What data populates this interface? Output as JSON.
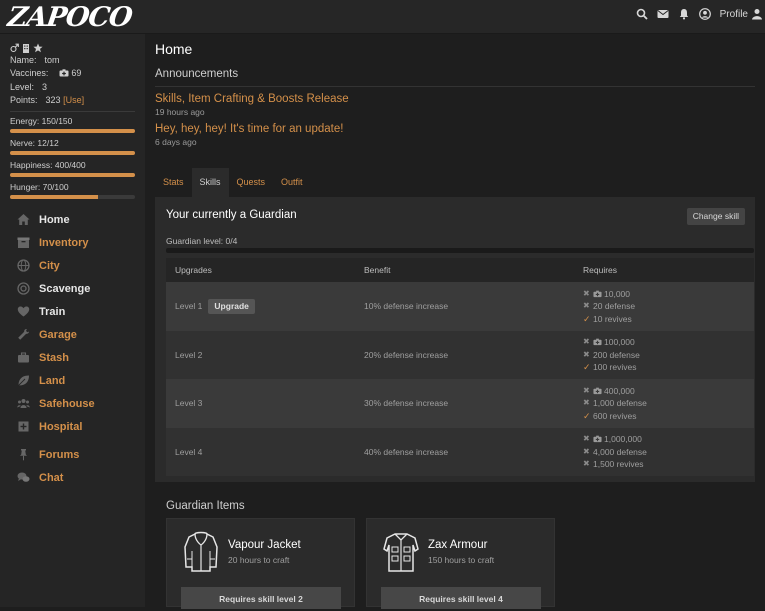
{
  "app": {
    "logo": "ZAPOCO"
  },
  "header": {
    "profile_label": "Profile"
  },
  "player": {
    "name_label": "Name:",
    "name": "tom",
    "vaccines_label": "Vaccines:",
    "vaccines": "69",
    "level_label": "Level:",
    "level": "3",
    "points_label": "Points:",
    "points": "323",
    "use_label": "[Use]"
  },
  "bars": [
    {
      "label": "Energy: 150/150",
      "fill": 1.0
    },
    {
      "label": "Nerve: 12/12",
      "fill": 1.0
    },
    {
      "label": "Happiness: 400/400",
      "fill": 1.0
    },
    {
      "label": "Hunger: 70/100",
      "fill": 0.7
    }
  ],
  "nav": [
    {
      "label": "Home",
      "icon": "home-icon"
    },
    {
      "label": "Inventory",
      "icon": "box-icon"
    },
    {
      "label": "City",
      "icon": "globe-icon"
    },
    {
      "label": "Scavenge",
      "icon": "target-icon"
    },
    {
      "label": "Train",
      "icon": "heart-icon"
    },
    {
      "label": "Garage",
      "icon": "wrench-icon"
    },
    {
      "label": "Stash",
      "icon": "briefcase-icon"
    },
    {
      "label": "Land",
      "icon": "leaf-icon"
    },
    {
      "label": "Safehouse",
      "icon": "people-icon"
    },
    {
      "label": "Hospital",
      "icon": "hospital-icon"
    },
    {
      "label": "Forums",
      "icon": "pin-icon"
    },
    {
      "label": "Chat",
      "icon": "chat-icon"
    }
  ],
  "page": {
    "title": "Home"
  },
  "announcements": {
    "title": "Announcements",
    "items": [
      {
        "title": "Skills, Item Crafting & Boosts Release",
        "date": "19 hours ago"
      },
      {
        "title": "Hey, hey, hey! It's time for an update!",
        "date": "6 days ago"
      }
    ]
  },
  "tabs": [
    "Stats",
    "Skills",
    "Quests",
    "Outfit"
  ],
  "skill": {
    "title": "Your currently a Guardian",
    "change_label": "Change skill",
    "level_label": "Guardian level: 0/4",
    "progress": 0,
    "headers": [
      "Upgrades",
      "Benefit",
      "Requires"
    ],
    "upgrade_label": "Upgrade",
    "rows": [
      {
        "level": "Level 1",
        "benefit": "10% defense increase",
        "req": [
          {
            "met": false,
            "vax": true,
            "text": "10,000"
          },
          {
            "met": false,
            "vax": false,
            "text": "20 defense"
          },
          {
            "met": true,
            "vax": false,
            "text": "10 revives"
          }
        ]
      },
      {
        "level": "Level 2",
        "benefit": "20% defense increase",
        "req": [
          {
            "met": false,
            "vax": true,
            "text": "100,000"
          },
          {
            "met": false,
            "vax": false,
            "text": "200 defense"
          },
          {
            "met": true,
            "vax": false,
            "text": "100 revives"
          }
        ]
      },
      {
        "level": "Level 3",
        "benefit": "30% defense increase",
        "req": [
          {
            "met": false,
            "vax": true,
            "text": "400,000"
          },
          {
            "met": false,
            "vax": false,
            "text": "1,000 defense"
          },
          {
            "met": true,
            "vax": false,
            "text": "600 revives"
          }
        ]
      },
      {
        "level": "Level 4",
        "benefit": "40% defense increase",
        "req": [
          {
            "met": false,
            "vax": true,
            "text": "1,000,000"
          },
          {
            "met": false,
            "vax": false,
            "text": "4,000 defense"
          },
          {
            "met": false,
            "vax": false,
            "text": "1,500 revives"
          }
        ]
      }
    ]
  },
  "items": {
    "title": "Guardian Items",
    "cards": [
      {
        "name": "Vapour Jacket",
        "time": "20 hours to craft",
        "button": "Requires skill level 2",
        "icon": "jacket-icon"
      },
      {
        "name": "Zax Armour",
        "time": "150 hours to craft",
        "button": "Requires skill level 4",
        "icon": "armour-icon"
      }
    ]
  },
  "colors": {
    "accent": "#d4904a",
    "bg": "#1e1e1e",
    "panel": "#2b2b2b"
  }
}
